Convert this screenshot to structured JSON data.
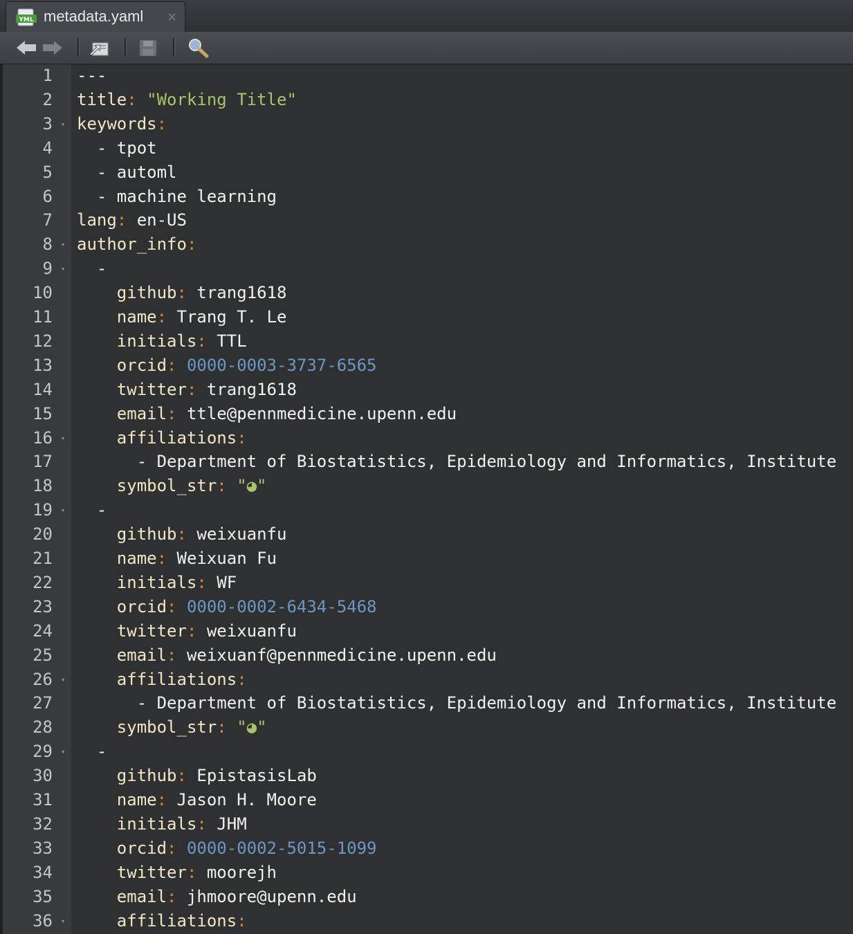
{
  "tab": {
    "title": "metadata.yaml",
    "icon_label": "YML",
    "close_glyph": "×"
  },
  "toolbar": {
    "buttons": [
      "back-arrow-icon",
      "forward-arrow-icon",
      "go-to-source-icon",
      "save-icon",
      "search-icon"
    ]
  },
  "colors": {
    "key": "#f2e6c5",
    "punctuation": "#d08a3b",
    "string": "#a7c46d",
    "number": "#6d97c4",
    "text": "#f1f1ee",
    "background": "#2f3032",
    "gutter": "#393a3d"
  },
  "editor": {
    "lines": [
      {
        "n": "1",
        "fold": false,
        "tokens": [
          {
            "t": "---",
            "c": "d"
          }
        ]
      },
      {
        "n": "2",
        "fold": false,
        "tokens": [
          {
            "t": "title",
            "c": "k"
          },
          {
            "t": ":",
            "c": "p"
          },
          {
            "t": " ",
            "c": "v"
          },
          {
            "t": "\"Working Title\"",
            "c": "s"
          }
        ]
      },
      {
        "n": "3",
        "fold": true,
        "tokens": [
          {
            "t": "keywords",
            "c": "k"
          },
          {
            "t": ":",
            "c": "p"
          }
        ]
      },
      {
        "n": "4",
        "fold": false,
        "tokens": [
          {
            "t": "  - tpot",
            "c": "v"
          }
        ]
      },
      {
        "n": "5",
        "fold": false,
        "tokens": [
          {
            "t": "  - automl",
            "c": "v"
          }
        ]
      },
      {
        "n": "6",
        "fold": false,
        "tokens": [
          {
            "t": "  - machine learning",
            "c": "v"
          }
        ]
      },
      {
        "n": "7",
        "fold": false,
        "tokens": [
          {
            "t": "lang",
            "c": "k"
          },
          {
            "t": ":",
            "c": "p"
          },
          {
            "t": " en-US",
            "c": "v"
          }
        ]
      },
      {
        "n": "8",
        "fold": true,
        "tokens": [
          {
            "t": "author_info",
            "c": "k"
          },
          {
            "t": ":",
            "c": "p"
          }
        ]
      },
      {
        "n": "9",
        "fold": true,
        "tokens": [
          {
            "t": "  -",
            "c": "v"
          }
        ]
      },
      {
        "n": "10",
        "fold": false,
        "tokens": [
          {
            "t": "    ",
            "c": "v"
          },
          {
            "t": "github",
            "c": "k"
          },
          {
            "t": ":",
            "c": "p"
          },
          {
            "t": " trang1618",
            "c": "v"
          }
        ]
      },
      {
        "n": "11",
        "fold": false,
        "tokens": [
          {
            "t": "    ",
            "c": "v"
          },
          {
            "t": "name",
            "c": "k"
          },
          {
            "t": ":",
            "c": "p"
          },
          {
            "t": " Trang T. Le",
            "c": "v"
          }
        ]
      },
      {
        "n": "12",
        "fold": false,
        "tokens": [
          {
            "t": "    ",
            "c": "v"
          },
          {
            "t": "initials",
            "c": "k"
          },
          {
            "t": ":",
            "c": "p"
          },
          {
            "t": " TTL",
            "c": "v"
          }
        ]
      },
      {
        "n": "13",
        "fold": false,
        "tokens": [
          {
            "t": "    ",
            "c": "v"
          },
          {
            "t": "orcid",
            "c": "k"
          },
          {
            "t": ":",
            "c": "p"
          },
          {
            "t": " ",
            "c": "v"
          },
          {
            "t": "0000-0003-3737-6565",
            "c": "n"
          }
        ]
      },
      {
        "n": "14",
        "fold": false,
        "tokens": [
          {
            "t": "    ",
            "c": "v"
          },
          {
            "t": "twitter",
            "c": "k"
          },
          {
            "t": ":",
            "c": "p"
          },
          {
            "t": " trang1618",
            "c": "v"
          }
        ]
      },
      {
        "n": "15",
        "fold": false,
        "tokens": [
          {
            "t": "    ",
            "c": "v"
          },
          {
            "t": "email",
            "c": "k"
          },
          {
            "t": ":",
            "c": "p"
          },
          {
            "t": " ttle@pennmedicine.upenn.edu",
            "c": "v"
          }
        ]
      },
      {
        "n": "16",
        "fold": true,
        "tokens": [
          {
            "t": "    ",
            "c": "v"
          },
          {
            "t": "affiliations",
            "c": "k"
          },
          {
            "t": ":",
            "c": "p"
          }
        ]
      },
      {
        "n": "17",
        "fold": false,
        "tokens": [
          {
            "t": "      - Department of Biostatistics, Epidemiology and Informatics, Institute",
            "c": "v"
          }
        ]
      },
      {
        "n": "18",
        "fold": false,
        "tokens": [
          {
            "t": "    ",
            "c": "v"
          },
          {
            "t": "symbol_str",
            "c": "k"
          },
          {
            "t": ":",
            "c": "p"
          },
          {
            "t": " ",
            "c": "v"
          },
          {
            "t": "\"◕\"",
            "c": "s"
          }
        ]
      },
      {
        "n": "19",
        "fold": true,
        "tokens": [
          {
            "t": "  -",
            "c": "v"
          }
        ]
      },
      {
        "n": "20",
        "fold": false,
        "tokens": [
          {
            "t": "    ",
            "c": "v"
          },
          {
            "t": "github",
            "c": "k"
          },
          {
            "t": ":",
            "c": "p"
          },
          {
            "t": " weixuanfu",
            "c": "v"
          }
        ]
      },
      {
        "n": "21",
        "fold": false,
        "tokens": [
          {
            "t": "    ",
            "c": "v"
          },
          {
            "t": "name",
            "c": "k"
          },
          {
            "t": ":",
            "c": "p"
          },
          {
            "t": " Weixuan Fu",
            "c": "v"
          }
        ]
      },
      {
        "n": "22",
        "fold": false,
        "tokens": [
          {
            "t": "    ",
            "c": "v"
          },
          {
            "t": "initials",
            "c": "k"
          },
          {
            "t": ":",
            "c": "p"
          },
          {
            "t": " WF",
            "c": "v"
          }
        ]
      },
      {
        "n": "23",
        "fold": false,
        "tokens": [
          {
            "t": "    ",
            "c": "v"
          },
          {
            "t": "orcid",
            "c": "k"
          },
          {
            "t": ":",
            "c": "p"
          },
          {
            "t": " ",
            "c": "v"
          },
          {
            "t": "0000-0002-6434-5468",
            "c": "n"
          }
        ]
      },
      {
        "n": "24",
        "fold": false,
        "tokens": [
          {
            "t": "    ",
            "c": "v"
          },
          {
            "t": "twitter",
            "c": "k"
          },
          {
            "t": ":",
            "c": "p"
          },
          {
            "t": " weixuanfu",
            "c": "v"
          }
        ]
      },
      {
        "n": "25",
        "fold": false,
        "tokens": [
          {
            "t": "    ",
            "c": "v"
          },
          {
            "t": "email",
            "c": "k"
          },
          {
            "t": ":",
            "c": "p"
          },
          {
            "t": " weixuanf@pennmedicine.upenn.edu",
            "c": "v"
          }
        ]
      },
      {
        "n": "26",
        "fold": true,
        "tokens": [
          {
            "t": "    ",
            "c": "v"
          },
          {
            "t": "affiliations",
            "c": "k"
          },
          {
            "t": ":",
            "c": "p"
          }
        ]
      },
      {
        "n": "27",
        "fold": false,
        "tokens": [
          {
            "t": "      - Department of Biostatistics, Epidemiology and Informatics, Institute",
            "c": "v"
          }
        ]
      },
      {
        "n": "28",
        "fold": false,
        "tokens": [
          {
            "t": "    ",
            "c": "v"
          },
          {
            "t": "symbol_str",
            "c": "k"
          },
          {
            "t": ":",
            "c": "p"
          },
          {
            "t": " ",
            "c": "v"
          },
          {
            "t": "\"◕\"",
            "c": "s"
          }
        ]
      },
      {
        "n": "29",
        "fold": true,
        "tokens": [
          {
            "t": "  -",
            "c": "v"
          }
        ]
      },
      {
        "n": "30",
        "fold": false,
        "tokens": [
          {
            "t": "    ",
            "c": "v"
          },
          {
            "t": "github",
            "c": "k"
          },
          {
            "t": ":",
            "c": "p"
          },
          {
            "t": " EpistasisLab",
            "c": "v"
          }
        ]
      },
      {
        "n": "31",
        "fold": false,
        "tokens": [
          {
            "t": "    ",
            "c": "v"
          },
          {
            "t": "name",
            "c": "k"
          },
          {
            "t": ":",
            "c": "p"
          },
          {
            "t": " Jason H. Moore",
            "c": "v"
          }
        ]
      },
      {
        "n": "32",
        "fold": false,
        "tokens": [
          {
            "t": "    ",
            "c": "v"
          },
          {
            "t": "initials",
            "c": "k"
          },
          {
            "t": ":",
            "c": "p"
          },
          {
            "t": " JHM",
            "c": "v"
          }
        ]
      },
      {
        "n": "33",
        "fold": false,
        "tokens": [
          {
            "t": "    ",
            "c": "v"
          },
          {
            "t": "orcid",
            "c": "k"
          },
          {
            "t": ":",
            "c": "p"
          },
          {
            "t": " ",
            "c": "v"
          },
          {
            "t": "0000-0002-5015-1099",
            "c": "n"
          }
        ]
      },
      {
        "n": "34",
        "fold": false,
        "tokens": [
          {
            "t": "    ",
            "c": "v"
          },
          {
            "t": "twitter",
            "c": "k"
          },
          {
            "t": ":",
            "c": "p"
          },
          {
            "t": " moorejh",
            "c": "v"
          }
        ]
      },
      {
        "n": "35",
        "fold": false,
        "tokens": [
          {
            "t": "    ",
            "c": "v"
          },
          {
            "t": "email",
            "c": "k"
          },
          {
            "t": ":",
            "c": "p"
          },
          {
            "t": " jhmoore@upenn.edu",
            "c": "v"
          }
        ]
      },
      {
        "n": "36",
        "fold": true,
        "tokens": [
          {
            "t": "    ",
            "c": "v"
          },
          {
            "t": "affiliations",
            "c": "k"
          },
          {
            "t": ":",
            "c": "p"
          }
        ]
      }
    ]
  }
}
